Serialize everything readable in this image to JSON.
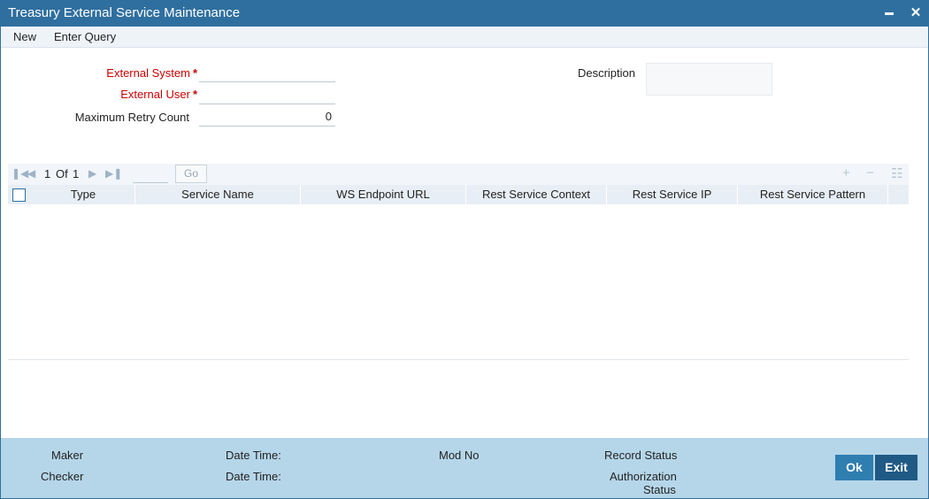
{
  "window": {
    "title": "Treasury External Service Maintenance",
    "minimize_symbol": "",
    "close_symbol": "✕"
  },
  "menu": {
    "new": "New",
    "enter_query": "Enter Query"
  },
  "form": {
    "external_system": {
      "label": "External System",
      "required_mark": "*",
      "value": ""
    },
    "external_user": {
      "label": "External User",
      "required_mark": "*",
      "value": ""
    },
    "max_retry": {
      "label": "Maximum Retry Count",
      "value": "0"
    },
    "description": {
      "label": "Description",
      "value": ""
    }
  },
  "pager": {
    "first_icon": "first-page-icon",
    "prev_icon": "prev-page-icon",
    "next_icon": "next-page-icon",
    "last_icon": "last-page-icon",
    "current": "1",
    "of": "Of",
    "total": "1",
    "go": "Go",
    "add_symbol": "+",
    "remove_symbol": "−",
    "settings_symbol": "☷"
  },
  "grid": {
    "columns": [
      "Type",
      "Service Name",
      "WS Endpoint URL",
      "Rest Service Context",
      "Rest Service IP",
      "Rest Service Pattern"
    ]
  },
  "footer": {
    "maker": "Maker",
    "checker": "Checker",
    "date_time_1": "Date Time:",
    "date_time_2": "Date Time:",
    "mod_no": "Mod No",
    "record_status": "Record Status",
    "authorization_status_1": "Authorization",
    "authorization_status_2": "Status",
    "ok": "Ok",
    "exit": "Exit"
  },
  "colors": {
    "titlebar": "#2f6f9f",
    "footer": "#b5d6e9",
    "required": "#cc0000",
    "ok_button": "#2f7eb0",
    "exit_button": "#1f5a85"
  }
}
